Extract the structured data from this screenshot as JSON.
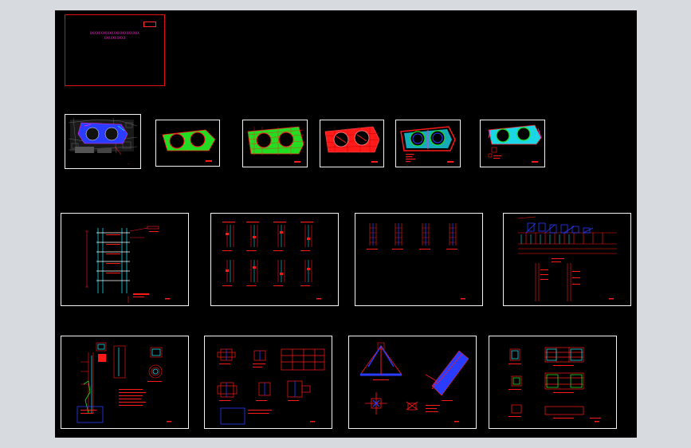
{
  "app": {
    "name": "AutoCAD drawing preview"
  },
  "title_block": {
    "line1": "XXXXXXXXXXXXXXXXXXXXXXX",
    "line2": "XXXXXXXXXX"
  },
  "colors": {
    "background": "#000000",
    "frame": "#f2f2f2",
    "red": "#ff1a1a",
    "green": "#22dd22",
    "cyan": "#1ad6e6",
    "magenta": "#ff2bd6",
    "blue": "#3a4bff",
    "yellow": "#ffe51a",
    "outer": "#d7dade"
  },
  "rows": {
    "plans": [
      "site-plan",
      "plan-green-1",
      "plan-green-2",
      "plan-red",
      "plan-mixed",
      "plan-cyan"
    ],
    "sections": [
      "wall-section",
      "column-details-a",
      "column-details-b",
      "truss-elevation"
    ],
    "details": [
      "foundation-detail",
      "joint-detail",
      "truss-joint-detail",
      "beam-detail"
    ]
  }
}
